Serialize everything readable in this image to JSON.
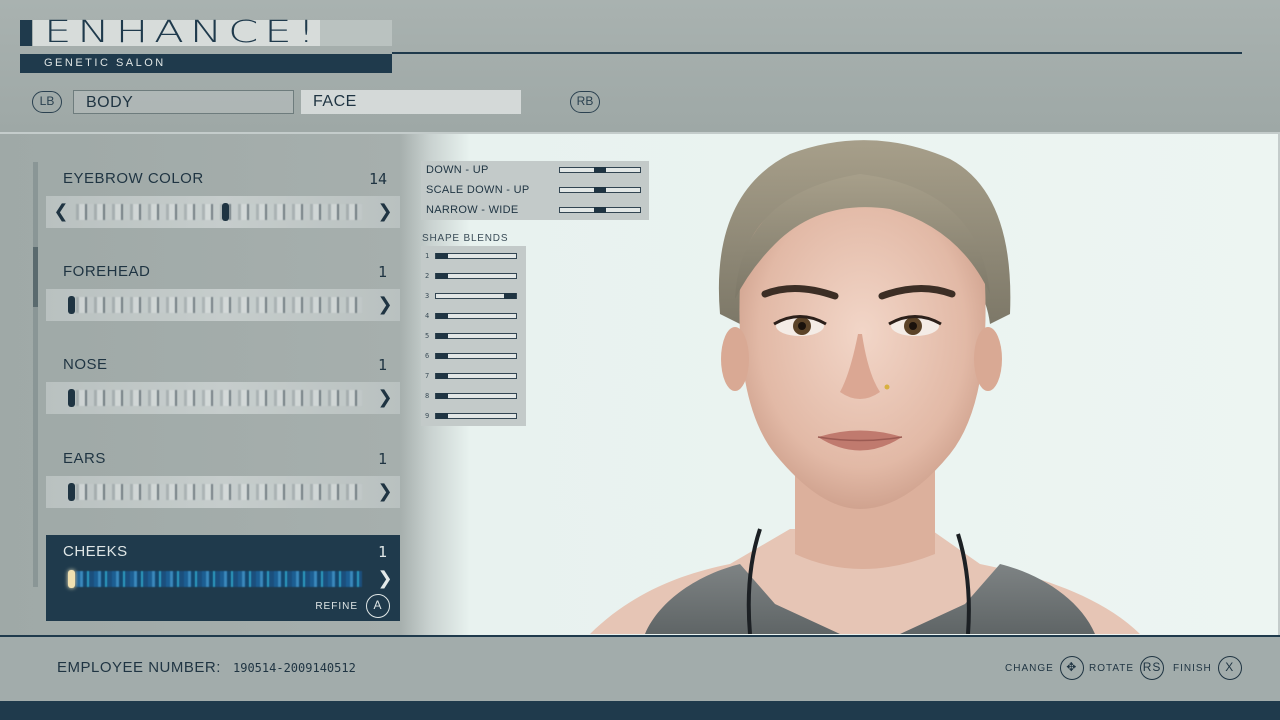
{
  "header": {
    "title": "ENHANCE!",
    "subtitle": "GENETIC SALON",
    "left_bumper": "LB",
    "right_bumper": "RB",
    "tabs": [
      {
        "label": "BODY",
        "selected": false
      },
      {
        "label": "FACE",
        "selected": true
      }
    ]
  },
  "features": [
    {
      "label": "EYEBROW COLOR",
      "value": "14",
      "level": 0.55,
      "active": false
    },
    {
      "label": "FOREHEAD",
      "value": "1",
      "level": 0.0,
      "active": false
    },
    {
      "label": "NOSE",
      "value": "1",
      "level": 0.0,
      "active": false
    },
    {
      "label": "EARS",
      "value": "1",
      "level": 0.0,
      "active": false
    },
    {
      "label": "CHEEKS",
      "value": "1",
      "level": 0.0,
      "active": true
    }
  ],
  "refine": {
    "label": "REFINE",
    "button": "A"
  },
  "adjustments": [
    {
      "label": "DOWN - UP",
      "level": 0.5
    },
    {
      "label": "SCALE DOWN - UP",
      "level": 0.5
    },
    {
      "label": "NARROW - WIDE",
      "level": 0.5
    }
  ],
  "shape_blends": {
    "title": "SHAPE BLENDS",
    "items": [
      {
        "num": "1",
        "level": 0.0
      },
      {
        "num": "2",
        "level": 0.0
      },
      {
        "num": "3",
        "level": 1.0
      },
      {
        "num": "4",
        "level": 0.0
      },
      {
        "num": "5",
        "level": 0.0
      },
      {
        "num": "6",
        "level": 0.0
      },
      {
        "num": "7",
        "level": 0.0
      },
      {
        "num": "8",
        "level": 0.0
      },
      {
        "num": "9",
        "level": 0.0
      }
    ]
  },
  "footer": {
    "employee_label": "EMPLOYEE NUMBER:",
    "employee_number": "190514-2009140512",
    "hints": [
      {
        "label": "CHANGE",
        "button": "✥"
      },
      {
        "label": "ROTATE",
        "button": "RS"
      },
      {
        "label": "FINISH",
        "button": "X"
      }
    ]
  },
  "colors": {
    "primary": "#1f3a4c",
    "panel": "#a6afad",
    "background": "#edf5f2"
  }
}
